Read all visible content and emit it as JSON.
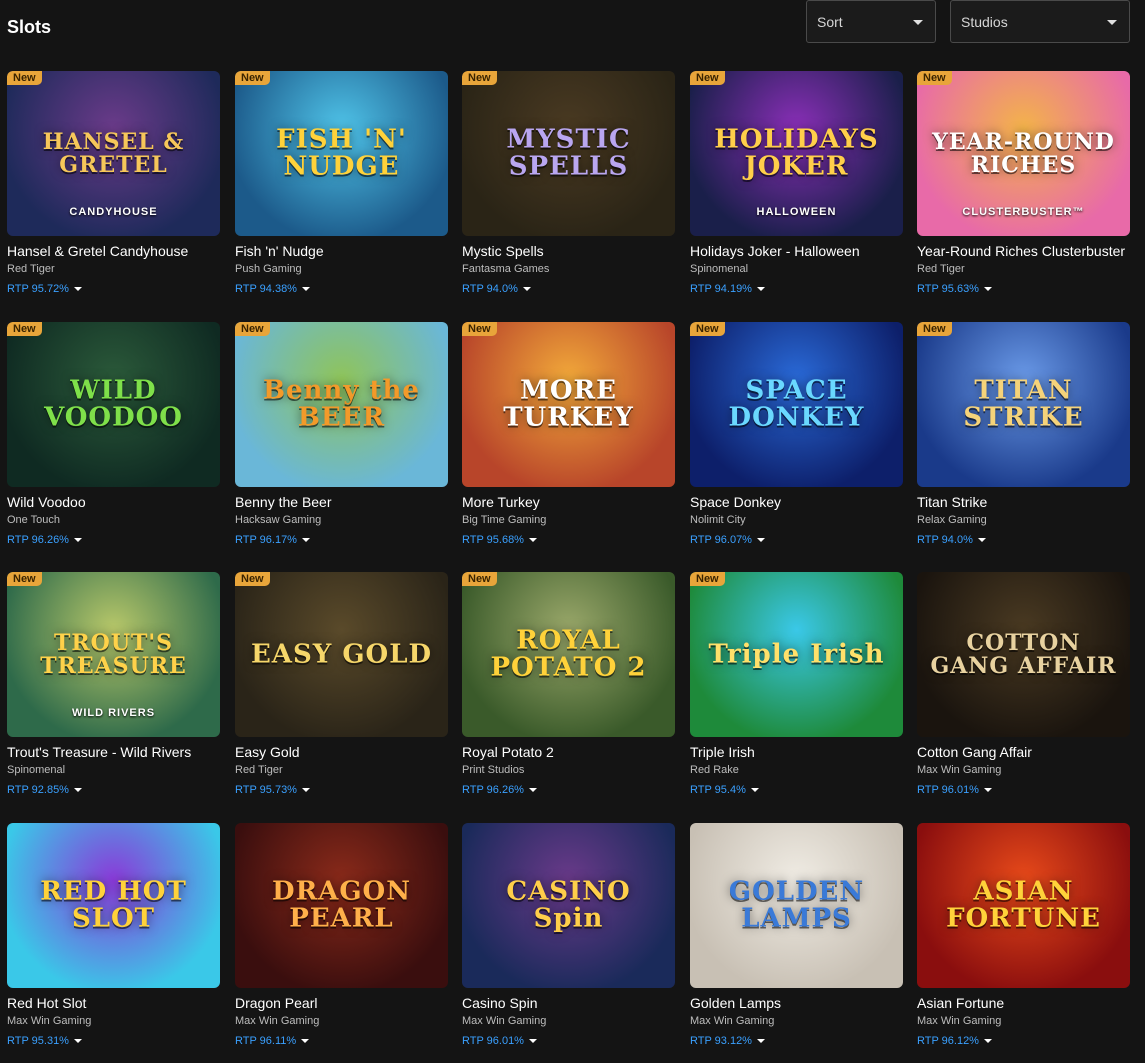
{
  "header": {
    "title": "Slots",
    "sort_label": "Sort",
    "studios_label": "Studios"
  },
  "games": [
    {
      "title": "Hansel & Gretel Candyhouse",
      "studio": "Red Tiger",
      "rtp": "RTP 95.72%",
      "badge": "New",
      "art": "HANSEL & GRETEL",
      "sub": "CANDYHOUSE",
      "c1": "#1e2a5a",
      "c2": "#6b3b8a",
      "tc": "#f6c75a"
    },
    {
      "title": "Fish 'n' Nudge",
      "studio": "Push Gaming",
      "rtp": "RTP 94.38%",
      "badge": "New",
      "art": "FISH 'N' NUDGE",
      "c1": "#1c5a8a",
      "c2": "#4fc3e8",
      "tc": "#ffd23a"
    },
    {
      "title": "Mystic Spells",
      "studio": "Fantasma Games",
      "rtp": "RTP 94.0%",
      "badge": "New",
      "art": "MYSTIC SPELLS",
      "c1": "#2a2416",
      "c2": "#4a3a22",
      "tc": "#b9a6f0"
    },
    {
      "title": "Holidays Joker - Halloween",
      "studio": "Spinomenal",
      "rtp": "RTP 94.19%",
      "badge": "New",
      "art": "HOLIDAYS JOKER",
      "sub": "HALLOWEEN",
      "c1": "#1a1f4a",
      "c2": "#8a2fb8",
      "tc": "#ffcf4a"
    },
    {
      "title": "Year-Round Riches Clusterbuster",
      "studio": "Red Tiger",
      "rtp": "RTP 95.63%",
      "badge": "New",
      "art": "YEAR-ROUND RICHES",
      "sub": "CLUSTERBUSTER™",
      "c1": "#e86aa8",
      "c2": "#f3b34a",
      "tc": "#ffffff"
    },
    {
      "title": "Wild Voodoo",
      "studio": "One Touch",
      "rtp": "RTP 96.26%",
      "badge": "New",
      "art": "WILD VOODOO",
      "c1": "#0f2a22",
      "c2": "#2b5a3a",
      "tc": "#7fe04a"
    },
    {
      "title": "Benny the Beer",
      "studio": "Hacksaw Gaming",
      "rtp": "RTP 96.17%",
      "badge": "New",
      "art": "Benny the BEER",
      "c1": "#6ab7d8",
      "c2": "#8fc45a",
      "tc": "#f39a2a"
    },
    {
      "title": "More Turkey",
      "studio": "Big Time Gaming",
      "rtp": "RTP 95.68%",
      "badge": "New",
      "art": "MORE TURKEY",
      "c1": "#b8452a",
      "c2": "#f2a93a",
      "tc": "#ffffff"
    },
    {
      "title": "Space Donkey",
      "studio": "Nolimit City",
      "rtp": "RTP 96.07%",
      "badge": "New",
      "art": "SPACE DONKEY",
      "c1": "#0d1f6a",
      "c2": "#2a6ad8",
      "tc": "#6ad8ff"
    },
    {
      "title": "Titan Strike",
      "studio": "Relax Gaming",
      "rtp": "RTP 94.0%",
      "badge": "New",
      "art": "TITAN STRIKE",
      "c1": "#1a3a8a",
      "c2": "#6a9ae8",
      "tc": "#f5d37a"
    },
    {
      "title": "Trout's Treasure - Wild Rivers",
      "studio": "Spinomenal",
      "rtp": "RTP 92.85%",
      "badge": "New",
      "art": "TROUT'S TREASURE",
      "sub": "WILD RIVERS",
      "c1": "#2e6a4a",
      "c2": "#b8c86a",
      "tc": "#ffd24a"
    },
    {
      "title": "Easy Gold",
      "studio": "Red Tiger",
      "rtp": "RTP 95.73%",
      "badge": "New",
      "art": "EASY GOLD",
      "c1": "#2a2418",
      "c2": "#5a4a2a",
      "tc": "#f6d66a"
    },
    {
      "title": "Royal Potato 2",
      "studio": "Print Studios",
      "rtp": "RTP 96.26%",
      "badge": "New",
      "art": "ROYAL POTATO 2",
      "c1": "#3a5a2a",
      "c2": "#9aa86a",
      "tc": "#ffd23a"
    },
    {
      "title": "Triple Irish",
      "studio": "Red Rake",
      "rtp": "RTP 95.4%",
      "badge": "New",
      "art": "Triple Irish",
      "c1": "#1e8a3a",
      "c2": "#3ac8e8",
      "tc": "#ffe06a"
    },
    {
      "title": "Cotton Gang Affair",
      "studio": "Max Win Gaming",
      "rtp": "RTP 96.01%",
      "badge": "",
      "art": "COTTON GANG AFFAIR",
      "c1": "#1a140e",
      "c2": "#4a3a22",
      "tc": "#e8d2a0"
    },
    {
      "title": "Red Hot Slot",
      "studio": "Max Win Gaming",
      "rtp": "RTP 95.31%",
      "badge": "",
      "art": "RED HOT SLOT",
      "c1": "#3ac8e8",
      "c2": "#8a3ad8",
      "tc": "#ffd23a"
    },
    {
      "title": "Dragon Pearl",
      "studio": "Max Win Gaming",
      "rtp": "RTP 96.11%",
      "badge": "",
      "art": "DRAGON PEARL",
      "c1": "#3a0e0e",
      "c2": "#8a2a1a",
      "tc": "#ffb04a"
    },
    {
      "title": "Casino Spin",
      "studio": "Max Win Gaming",
      "rtp": "RTP 96.01%",
      "badge": "",
      "art": "CASINO Spin",
      "c1": "#1a2a5a",
      "c2": "#6a3a8a",
      "tc": "#ffcf4a"
    },
    {
      "title": "Golden Lamps",
      "studio": "Max Win Gaming",
      "rtp": "RTP 93.12%",
      "badge": "",
      "art": "GOLDEN LAMPS",
      "c1": "#c8c0b4",
      "c2": "#f0ece4",
      "tc": "#3a7ad8"
    },
    {
      "title": "Asian Fortune",
      "studio": "Max Win Gaming",
      "rtp": "RTP 96.12%",
      "badge": "",
      "art": "ASIAN FORTUNE",
      "c1": "#8a0e0e",
      "c2": "#e84a1a",
      "tc": "#ffd23a"
    }
  ]
}
